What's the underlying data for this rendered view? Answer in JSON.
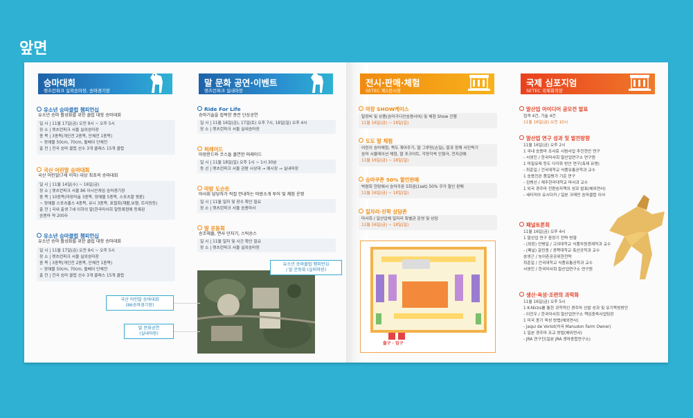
{
  "page_label": "앞면",
  "panels": {
    "race": {
      "title": "승마대회",
      "sub": "렛츠런파크 실외승마장, 승마경기장",
      "sections": [
        {
          "title": "유소년 승마클럽 챔피언십",
          "desc": "유소년 승마 활성화를 위한 클럽 대항 승마대회",
          "rows": [
            "일 시 | 11월 17일(금) 오전 9시 ~ 오후 5시",
            "장 소 | 렛츠런파크 서울 실외승마장",
            "종 목 | 3종목(개인전 2종목, 단체전 1종목)",
            "    ~ 장애물 50cm, 70cm, 돌배이 단체전",
            "출 전 | 전국 승마 클럽 선수 3개 클래스 15개 클럽"
          ]
        },
        {
          "title": "국산 어린말 승마대회",
          "desc": "국산 어린말(7세 이하) 대상 최초의 승마대회",
          "rows": [
            "일 시 | 11월 14일(수) ~ 16일(금)",
            "장 소 | 렛츠런파크 서울 86 아시안게임 승마경기장",
            "종 목 | 10종목(마장마술 3종목, 장애물 5종목, 스포츠말 평론)",
            "    ~ 장애물 스포츠홀스 4종목, 유니 3종목, 표절회(재활,보행, 트리밍등)",
            "출 전 | 국내 출생 7세 이하의 말(한국마사회 말등록원에 등록된",
            "    승용마 약 200두"
          ]
        },
        {
          "title": "유소년 승마클럽 챔피언십",
          "desc": "유소년 승마 활성화를 위한 클럽 대항 승마대회",
          "rows": [
            "일 시 | 11월 17일(금) 오전 9시 ~ 오후 5시",
            "장 소 | 렛츠런파크 서울 실외승마장",
            "종 목 | 3종목(개인전 2종목, 단체전 1종목)",
            "    ~ 장애물 50cm, 70cm, 돌배이 단체전",
            "출 전 | 전국 승마 클럽 선수 3개 클래스 15개 클럽"
          ]
        }
      ]
    },
    "culture": {
      "title": "말 문화 공연·이벤트",
      "sub": "렛츠런파크 실내마장",
      "sections": [
        {
          "title": "Ride For Life",
          "desc": "승마기술을 접목한 종전 단상공연",
          "rows": [
            "일 시 | 11월 16일(금), 17일(토) 오후 7시, 18일(일) 오후 4시",
            "장 소 | 렛츠런파크 서울 실내승마장"
          ]
        },
        {
          "title": "퍼레이드",
          "desc": "마장한드와 코스들 출연한 퍼레이드",
          "rows": [
            "일 시 | 11월 18일(일) 오후 1시 ~ 1시 30분",
            "동 선 | 렛츠런파크 서울 관람 시상대 → 에시장 → 실내마장"
          ]
        },
        {
          "title": "마방 도슨트",
          "desc": "마사회 담당자가 직접 안내하는 마방소개 투어 및 체험 운영",
          "rows": [
            "일 시 | 11월 일자 및 장수 확인 필요",
            "장 소 | 렛츠런파크 서울 승용마사"
          ]
        },
        {
          "title": "말 운동회",
          "desc": "승조체줄, 면사 던지기, 스틱승스",
          "rows": [
            "일 시 | 11월 일자 및 시간 확인 필요",
            "장 소 | 렛츠런파크 서울 실외승마장"
          ]
        }
      ],
      "callouts": {
        "champ": "유소년 승마클럽 챔피언십\n/ 말 운동회 (실외마장)",
        "young": "국산 어린말 승마대회\n(86승마경기장)",
        "show": "말 문화공연\n(실내마장)"
      }
    },
    "expo": {
      "title": "전시·판매·체험",
      "sub": "SETEC 제1전시장",
      "sections": [
        {
          "title": "마장 SHOW케이스",
          "rows": [
            "말장비 및 상품(승마가디언승용사여) 및 체험 Show 진행",
            "11월 16일(금) ~ 18일(일)"
          ]
        },
        {
          "title": "도도 말 체험",
          "rows": [
            "어린이 승마체험, 목도 계아주기, 말 그루밍(손질), 말과 함께 사진찍기",
            "승마 시뮬레이션 체험, 말 포크아트, 각양각색 인형극, 전자관에",
            "11월 16일(금) ~ 18일(일)"
          ]
        },
        {
          "title": "승마쿠폰 50% 할인판매",
          "rows": [
            "박람회 현장에서 승마쿠폰 5회권(1set) 50% 쿠가 할인 판매",
            "11월 16일(금) ~ 18일(일)"
          ]
        },
        {
          "title": "일자리·진학 상담존",
          "rows": [
            "마사회 / 일산업체 일자리 특별관 운영 및 상담",
            "11월 16일(금) ~ 18일(일)"
          ]
        }
      ],
      "exits": "출구 · 입구"
    },
    "symposium": {
      "title": "국제 심포지엄",
      "sub": "SETEC 국제회의장",
      "sections": [
        {
          "title": "말산업 아이디어 공모전 발표",
          "rows": [
            "접객 4건, 기술 4건",
            "11월 16일(금) 오전 10시"
          ]
        },
        {
          "title": "말산업 연구 성과 및 발전방향",
          "rows": [
            "11월 16일(금) 오후 2시",
            "1 국내 승용마 조사료 시범사업 추진현안 연구",
            "  - 서영진 / 한국마사회 말산업연구소 연구원",
            "1 마필유래 등도 다각화 방안 연구(축제 유명)",
            "  - 최춘일 / 건국대학교 식품유통공학과 교수",
            "1 승용진완 품질평가 기준 연구",
            "  - 김병선 / 제주한라대학교 마사과 교수",
            "1 외국 경주마 전환승자책의 성과 발표(해외연사)",
            "  - 세티미아 요시다카 / 일본 크레민 승마클럽 이사"
          ]
        },
        {
          "title": "패널토론회",
          "rows": [
            "11월 16일(금) 오후 4시",
            "1 말산업 연구 중장기 전략 방향",
            "  - (좌장) 안병일 / 고려대학교 식품자원경제학과 교수",
            "  - (패널) 윤민종 / 경북대학교 축산공학과 교수",
            "         송영근 / 농어촌공공위한전략",
            "         최춘일 / 건국대학교 식품유통공학과 교수",
            "         서영진 / 한국마사회 말산업연구소 연구원"
          ]
        },
        {
          "title": "생산·육성·조련의 과학화",
          "rows": [
            "11월 16일(금) 오후 5시",
            "1 K-Nicks를 통한 과학적인 경주마 선발 성과 및 유기목빙방안",
            "  - 이진우 / 한국마사회 말산업연구소 책임중육사업팀장",
            "1 미국 종기 육성 방법(해외연사)",
            "  - Jaqui de Vorlot(미국 Manudon Farm Owner)",
            "1 일본 경주마 조교 방법(해외연사)",
            "  - JRA 연구진(일본 JRA 경마종합연구소)"
          ]
        }
      ]
    }
  },
  "colors": {
    "background": "#2fb1d3",
    "blue": "#1f6ab0",
    "orange": "#ee8a12",
    "red": "#e2432a"
  }
}
